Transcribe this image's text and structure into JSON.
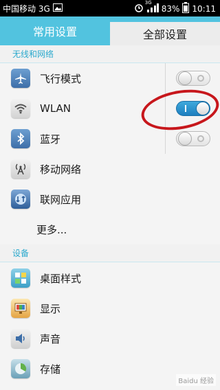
{
  "status_bar": {
    "carrier": "中国移动 3G",
    "network_badge": "3G",
    "battery": "83%",
    "time": "10:11",
    "icons": [
      "alarm-icon",
      "signal-icon",
      "battery-icon",
      "image-icon"
    ]
  },
  "tabs": [
    {
      "label": "常用设置",
      "active": false
    },
    {
      "label": "全部设置",
      "active": true
    }
  ],
  "sections": [
    {
      "title": "无线和网络",
      "items": [
        {
          "label": "飞行模式",
          "icon": "airplane-icon",
          "toggle": false
        },
        {
          "label": "WLAN",
          "icon": "wifi-icon",
          "toggle": true
        },
        {
          "label": "蓝牙",
          "icon": "bluetooth-icon",
          "toggle": false
        },
        {
          "label": "移动网络",
          "icon": "mobile-network-icon"
        },
        {
          "label": "联网应用",
          "icon": "network-apps-icon"
        },
        {
          "label": "更多..."
        }
      ]
    },
    {
      "title": "设备",
      "items": [
        {
          "label": "桌面样式",
          "icon": "desktop-style-icon"
        },
        {
          "label": "显示",
          "icon": "display-icon"
        },
        {
          "label": "声音",
          "icon": "sound-icon"
        },
        {
          "label": "存储",
          "icon": "storage-icon"
        }
      ]
    }
  ],
  "colors": {
    "accent": "#52c3df",
    "section_title": "#2ba9cd",
    "toggle_on": "#1d7fbf",
    "annotation": "#c7171c"
  },
  "watermark": "Baidu 经验"
}
